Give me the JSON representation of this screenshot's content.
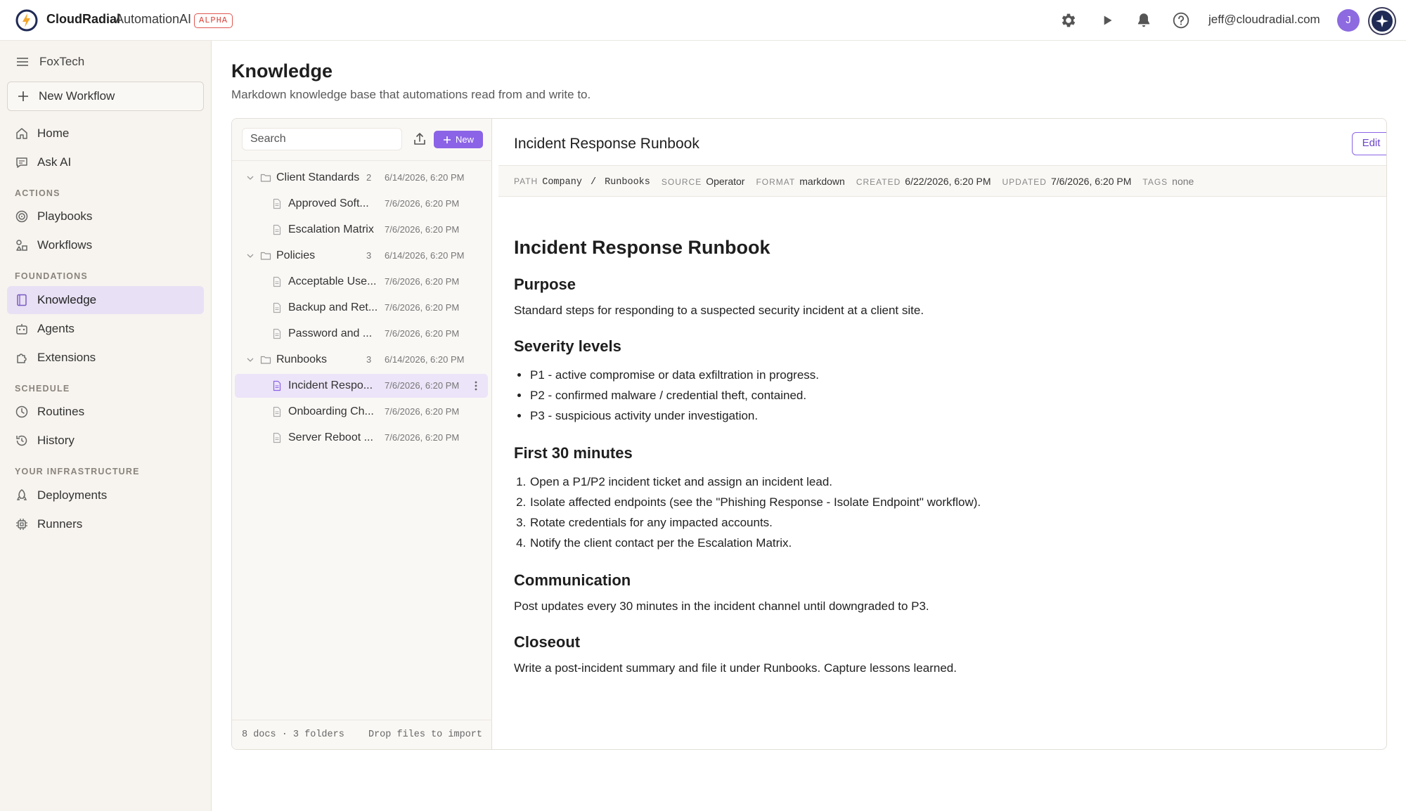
{
  "brand": {
    "name": "CloudRadial",
    "product": "AutomationAI",
    "badge": "ALPHA"
  },
  "header": {
    "user_email": "jeff@cloudradial.com",
    "avatar_initial": "J"
  },
  "sidebar": {
    "org": "FoxTech",
    "new_workflow": "New Workflow",
    "items": [
      {
        "label": "Home"
      },
      {
        "label": "Ask AI"
      },
      {
        "label": "Playbooks"
      },
      {
        "label": "Workflows"
      },
      {
        "label": "Knowledge"
      },
      {
        "label": "Agents"
      },
      {
        "label": "Extensions"
      },
      {
        "label": "Routines"
      },
      {
        "label": "History"
      },
      {
        "label": "Deployments"
      },
      {
        "label": "Runners"
      }
    ],
    "sections": [
      "ACTIONS",
      "FOUNDATIONS",
      "SCHEDULE",
      "YOUR INFRASTRUCTURE"
    ],
    "active": "Knowledge"
  },
  "page": {
    "title": "Knowledge",
    "subtitle": "Markdown knowledge base that automations read from and write to."
  },
  "tree": {
    "search_placeholder": "Search",
    "new_label": "New",
    "rows": [
      {
        "name": "Client Standards",
        "count": "2",
        "date": "6/14/2026, 6:20 PM"
      },
      {
        "name": "Approved Soft...",
        "date": "7/6/2026, 6:20 PM"
      },
      {
        "name": "Escalation Matrix",
        "date": "7/6/2026, 6:20 PM"
      },
      {
        "name": "Policies",
        "count": "3",
        "date": "6/14/2026, 6:20 PM"
      },
      {
        "name": "Acceptable Use...",
        "date": "7/6/2026, 6:20 PM"
      },
      {
        "name": "Backup and Ret...",
        "date": "7/6/2026, 6:20 PM"
      },
      {
        "name": "Password and ...",
        "date": "7/6/2026, 6:20 PM"
      },
      {
        "name": "Runbooks",
        "count": "3",
        "date": "6/14/2026, 6:20 PM"
      },
      {
        "name": "Incident Respo...",
        "date": "7/6/2026, 6:20 PM"
      },
      {
        "name": "Onboarding Ch...",
        "date": "7/6/2026, 6:20 PM"
      },
      {
        "name": "Server Reboot ...",
        "date": "7/6/2026, 6:20 PM"
      }
    ],
    "footer_left": "8 docs · 3 folders",
    "footer_right": "Drop files to import"
  },
  "doc": {
    "title": "Incident Response Runbook",
    "edit_label": "Edit",
    "meta": {
      "path_label": "PATH",
      "path_a": "Company",
      "path_sep": "/",
      "path_b": "Runbooks",
      "source_label": "SOURCE",
      "source": "Operator",
      "format_label": "FORMAT",
      "format": "markdown",
      "created_label": "CREATED",
      "created": "6/22/2026, 6:20 PM",
      "updated_label": "UPDATED",
      "updated": "7/6/2026, 6:20 PM",
      "tags_label": "TAGS",
      "tags": "none"
    },
    "body": {
      "h1": "Incident Response Runbook",
      "purpose_h": "Purpose",
      "purpose_p": "Standard steps for responding to a suspected security incident at a client site.",
      "severity_h": "Severity levels",
      "severity": [
        "P1 - active compromise or data exfiltration in progress.",
        "P2 - confirmed malware / credential theft, contained.",
        "P3 - suspicious activity under investigation."
      ],
      "first_h": "First 30 minutes",
      "first": [
        "Open a P1/P2 incident ticket and assign an incident lead.",
        "Isolate affected endpoints (see the \"Phishing Response - Isolate Endpoint\" workflow).",
        "Rotate credentials for any impacted accounts.",
        "Notify the client contact per the Escalation Matrix."
      ],
      "comm_h": "Communication",
      "comm_p": "Post updates every 30 minutes in the incident channel until downgraded to P3.",
      "close_h": "Closeout",
      "close_p": "Write a post-incident summary and file it under Runbooks. Capture lessons learned."
    }
  },
  "colors": {
    "accent": "#8b63e6",
    "sidebar_bg": "#f7f4ef",
    "active_bg": "#e8e0f4",
    "badge": "#d9443c"
  }
}
